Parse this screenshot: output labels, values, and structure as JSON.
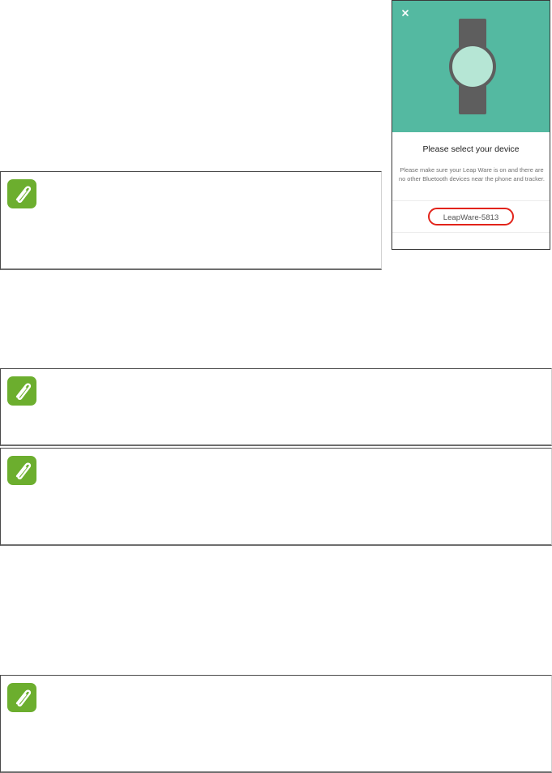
{
  "phone_screen": {
    "title": "Please select your device",
    "description": "Please make sure your Leap Ware is on and there are no other Bluetooth devices near the phone and tracker.",
    "device_name": "LeapWare-5813",
    "close_icon": "close-icon",
    "hero_color": "#54b9a1",
    "highlight_color": "#e2231a"
  },
  "notes": [
    {
      "icon": "paperclip-icon"
    },
    {
      "icon": "paperclip-icon"
    },
    {
      "icon": "paperclip-icon"
    },
    {
      "icon": "paperclip-icon"
    }
  ],
  "colors": {
    "note_icon_bg": "#6cae2e"
  }
}
